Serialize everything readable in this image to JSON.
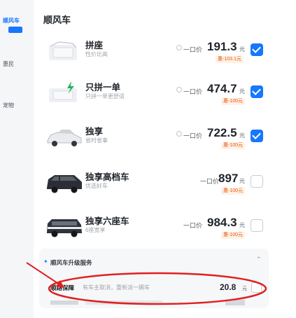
{
  "sidebar": {
    "items": [
      {
        "label": "顺风车"
      },
      {
        "label": "惠民"
      },
      {
        "label": "宠物"
      }
    ]
  },
  "section_title": "顺风车",
  "options": [
    {
      "name": "拼座",
      "sub": "性价比高",
      "prefix": "一口价",
      "price": "191.3",
      "unit": "元",
      "discount": "惠-103.1元",
      "checked": true,
      "info": true,
      "icon": "seat-car-icon"
    },
    {
      "name": "只拼一单",
      "sub": "只拼一单更舒适",
      "prefix": "一口价",
      "price": "474.7",
      "unit": "元",
      "discount": "惠-100元",
      "checked": true,
      "info": true,
      "icon": "lightning-seat-icon"
    },
    {
      "name": "独享",
      "sub": "省时省事",
      "prefix": "一口价",
      "price": "722.5",
      "unit": "元",
      "discount": "惠-100元",
      "checked": true,
      "info": true,
      "icon": "sedan-car-icon"
    },
    {
      "name": "独享高档车",
      "sub": "优选好车",
      "prefix": "一口价",
      "price": "897",
      "unit": "元",
      "discount": "惠-100元",
      "checked": false,
      "info": false,
      "icon": "suv-car-icon"
    },
    {
      "name": "独享六座车",
      "sub": "6座宽享",
      "prefix": "一口价",
      "price": "984.3",
      "unit": "元",
      "discount": "惠-100元",
      "checked": false,
      "info": false,
      "icon": "van-car-icon"
    }
  ],
  "upgrade": {
    "title": "顺风车升级服务",
    "service_name": "顺路保障",
    "service_desc": "有车主取消，重新派一辆车",
    "service_price": "20.8",
    "service_unit": "元"
  },
  "colors": {
    "accent": "#1677ff",
    "annotation": "#e02020",
    "discount": "#e8590c"
  }
}
